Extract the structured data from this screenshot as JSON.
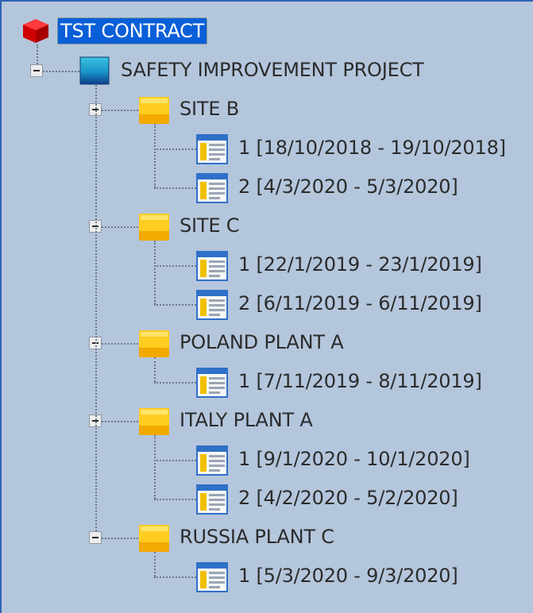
{
  "tree": {
    "root": {
      "label": "TST CONTRACT",
      "icon": "red-cube-icon",
      "selected": true
    },
    "project": {
      "label": "SAFETY IMPROVEMENT PROJECT",
      "icon": "project-box-icon"
    },
    "sites": [
      {
        "label": "SITE B",
        "icon": "site-folder-icon",
        "items": [
          {
            "label": "1 [18/10/2018 - 19/10/2018]",
            "icon": "form-icon"
          },
          {
            "label": "2 [4/3/2020 - 5/3/2020]",
            "icon": "form-icon"
          }
        ]
      },
      {
        "label": "SITE C",
        "icon": "site-folder-icon",
        "items": [
          {
            "label": "1 [22/1/2019 - 23/1/2019]",
            "icon": "form-icon"
          },
          {
            "label": "2 [6/11/2019 - 6/11/2019]",
            "icon": "form-icon"
          }
        ]
      },
      {
        "label": "POLAND PLANT A",
        "icon": "site-folder-icon",
        "items": [
          {
            "label": "1 [7/11/2019 - 8/11/2019]",
            "icon": "form-icon"
          }
        ]
      },
      {
        "label": "ITALY PLANT A",
        "icon": "site-folder-icon",
        "items": [
          {
            "label": "1 [9/1/2020 - 10/1/2020]",
            "icon": "form-icon"
          },
          {
            "label": "2 [4/2/2020 - 5/2/2020]",
            "icon": "form-icon"
          }
        ]
      },
      {
        "label": "RUSSIA PLANT C",
        "icon": "site-folder-icon",
        "items": [
          {
            "label": "1 [5/3/2020 - 9/3/2020]",
            "icon": "form-icon"
          }
        ]
      }
    ]
  },
  "colors": {
    "background": "#b4c6dc",
    "selection": "#0a5fd8",
    "text": "#2b2b2b"
  }
}
